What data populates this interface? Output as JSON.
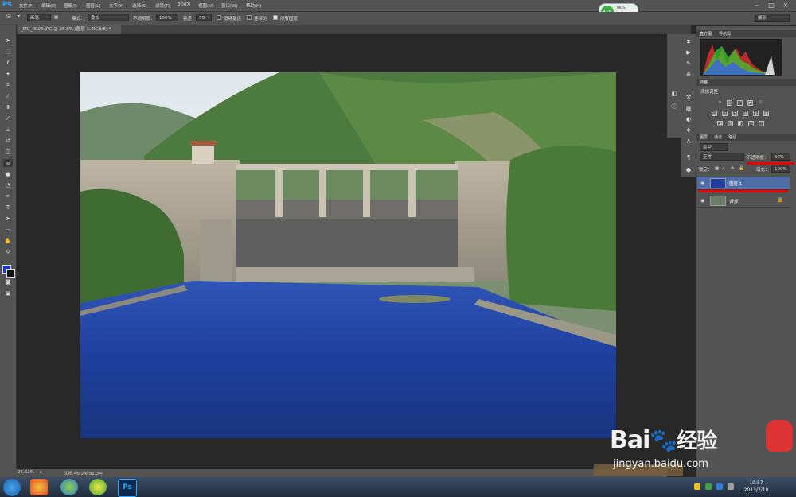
{
  "menu": {
    "logo": "Ps",
    "items": [
      "文件(F)",
      "编辑(E)",
      "图像(I)",
      "图层(L)",
      "文字(Y)",
      "选择(S)",
      "滤镜(T)",
      "3D(D)",
      "视图(V)",
      "窗口(W)",
      "帮助(H)"
    ]
  },
  "window_controls": {
    "minimize": "–",
    "maximize": "□",
    "close": "×"
  },
  "net_widget": {
    "gauge": "41%",
    "up": "0K/S",
    "down": "0K/S"
  },
  "options": {
    "brush_preset": "画笔",
    "mode_label": "模式：",
    "mode_value": "叠加",
    "opacity_label": "不透明度：",
    "opacity_value": "100%",
    "tolerance_label": "容差：",
    "tolerance_value": "50",
    "antialias_label": "消除锯齿",
    "contiguous_label": "连续的",
    "all_layers_label": "所有图层",
    "workspace": "摄影"
  },
  "document": {
    "tab_title": "_MG_0024.JPG @ 26.6% (图层 1, RGB/8) *",
    "zoom": "26.62%",
    "doc_size": "文档:46.2M/92.3M"
  },
  "panels": {
    "histogram_tab": "直方图",
    "navigator_tab": "导航器",
    "adjustments_tab": "调整",
    "add_adjustment": "添加调整",
    "layers_tab": "图层",
    "channels_tab": "通道",
    "paths_tab": "路径",
    "kind": "类型",
    "blend_mode": "正常",
    "opacity_label": "不透明度：",
    "opacity_value": "52%",
    "lock_label": "锁定：",
    "fill_label": "填充：",
    "fill_value": "100%",
    "layers": [
      {
        "name": "图层 1",
        "selected": true
      },
      {
        "name": "背景",
        "selected": false
      }
    ]
  },
  "taskbar": {
    "time": "10:57",
    "date": "2013/7/10"
  },
  "watermark": {
    "brand": "Bai",
    "brand2": "经验",
    "url": "jingyan.baidu.com"
  },
  "colors": {
    "foreground": "#1538c8",
    "background": "#111111",
    "highlight_red": "#e00000"
  }
}
